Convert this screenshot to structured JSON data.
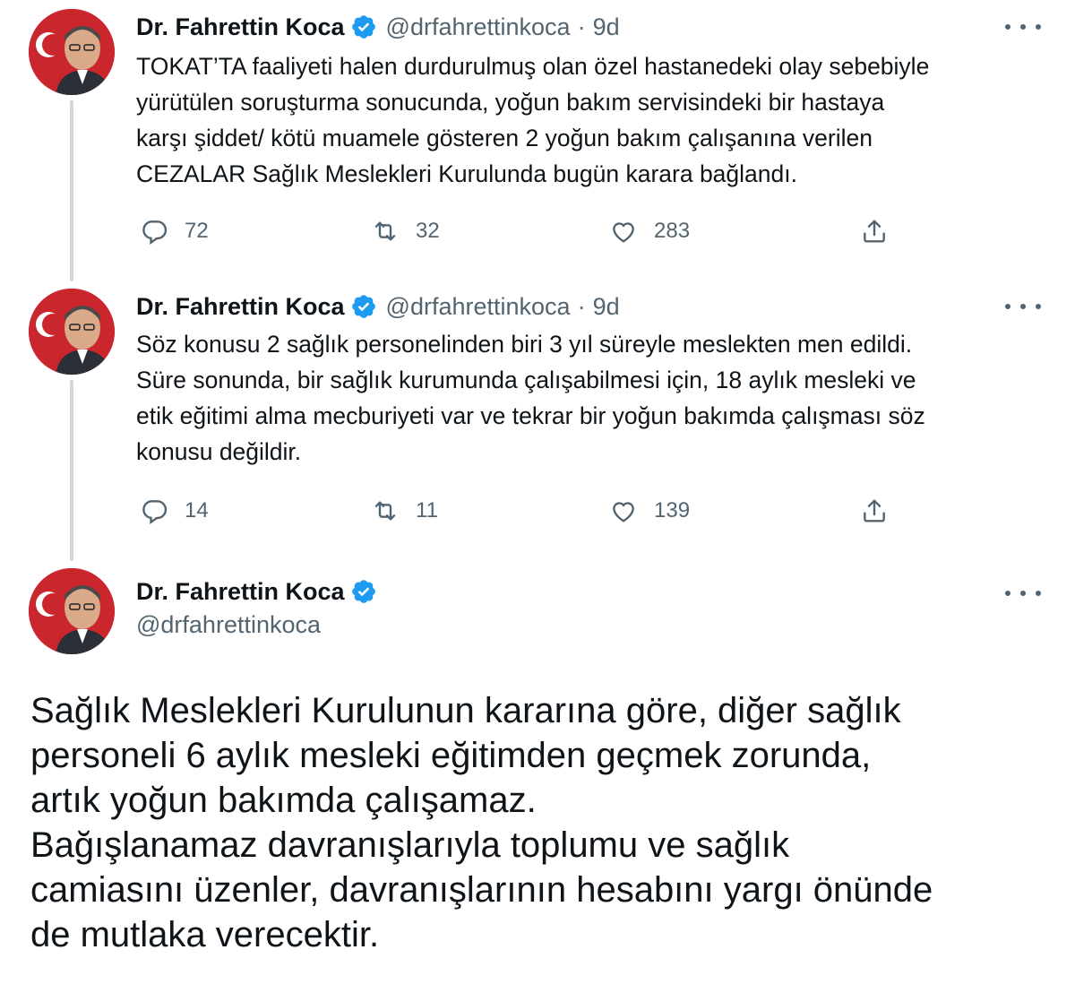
{
  "tweets": [
    {
      "author": "Dr. Fahrettin Koca",
      "handle": "@drfahrettinkoca",
      "separator": "·",
      "time": "9d",
      "text": "TOKAT’TA faaliyeti halen durdurulmuş olan özel hastanedeki olay sebebiyle\nyürütülen soruşturma sonucunda, yoğun bakım servisindeki bir hastaya\nkarşı şiddet/ kötü muamele gösteren 2 yoğun bakım çalışanına verilen\nCEZALAR Sağlık Meslekleri Kurulunda bugün karara bağlandı.",
      "replies": "72",
      "retweets": "32",
      "likes": "283"
    },
    {
      "author": "Dr. Fahrettin Koca",
      "handle": "@drfahrettinkoca",
      "separator": "·",
      "time": "9d",
      "text": "Söz konusu 2 sağlık personelinden biri 3 yıl süreyle meslekten men edildi.\nSüre sonunda, bir sağlık kurumunda çalışabilmesi için, 18 aylık mesleki ve\netik eğitimi alma mecburiyeti var ve tekrar bir yoğun bakımda çalışması söz\nkonusu değildir.",
      "replies": "14",
      "retweets": "11",
      "likes": "139"
    }
  ],
  "main_tweet": {
    "author": "Dr. Fahrettin Koca",
    "handle": "@drfahrettinkoca",
    "text": "Sağlık Meslekleri Kurulunun kararına göre, diğer sağlık\npersoneli 6 aylık mesleki eğitimden geçmek zorunda,\nartık yoğun bakımda çalışamaz.\nBağışlanamaz davranışlarıyla toplumu ve sağlık\ncamiasını üzenler, davranışlarının hesabını yargı önünde\nde mutlaka verecektir."
  },
  "icons": {
    "reply": "reply-icon",
    "retweet": "retweet-icon",
    "like": "heart-icon",
    "share": "share-icon",
    "more": "more-icon",
    "verified": "verified-badge-icon"
  },
  "colors": {
    "verified": "#1d9bf0",
    "secondary_text": "#536471",
    "primary_text": "#0f1419",
    "thread_line": "#cfd9de"
  }
}
